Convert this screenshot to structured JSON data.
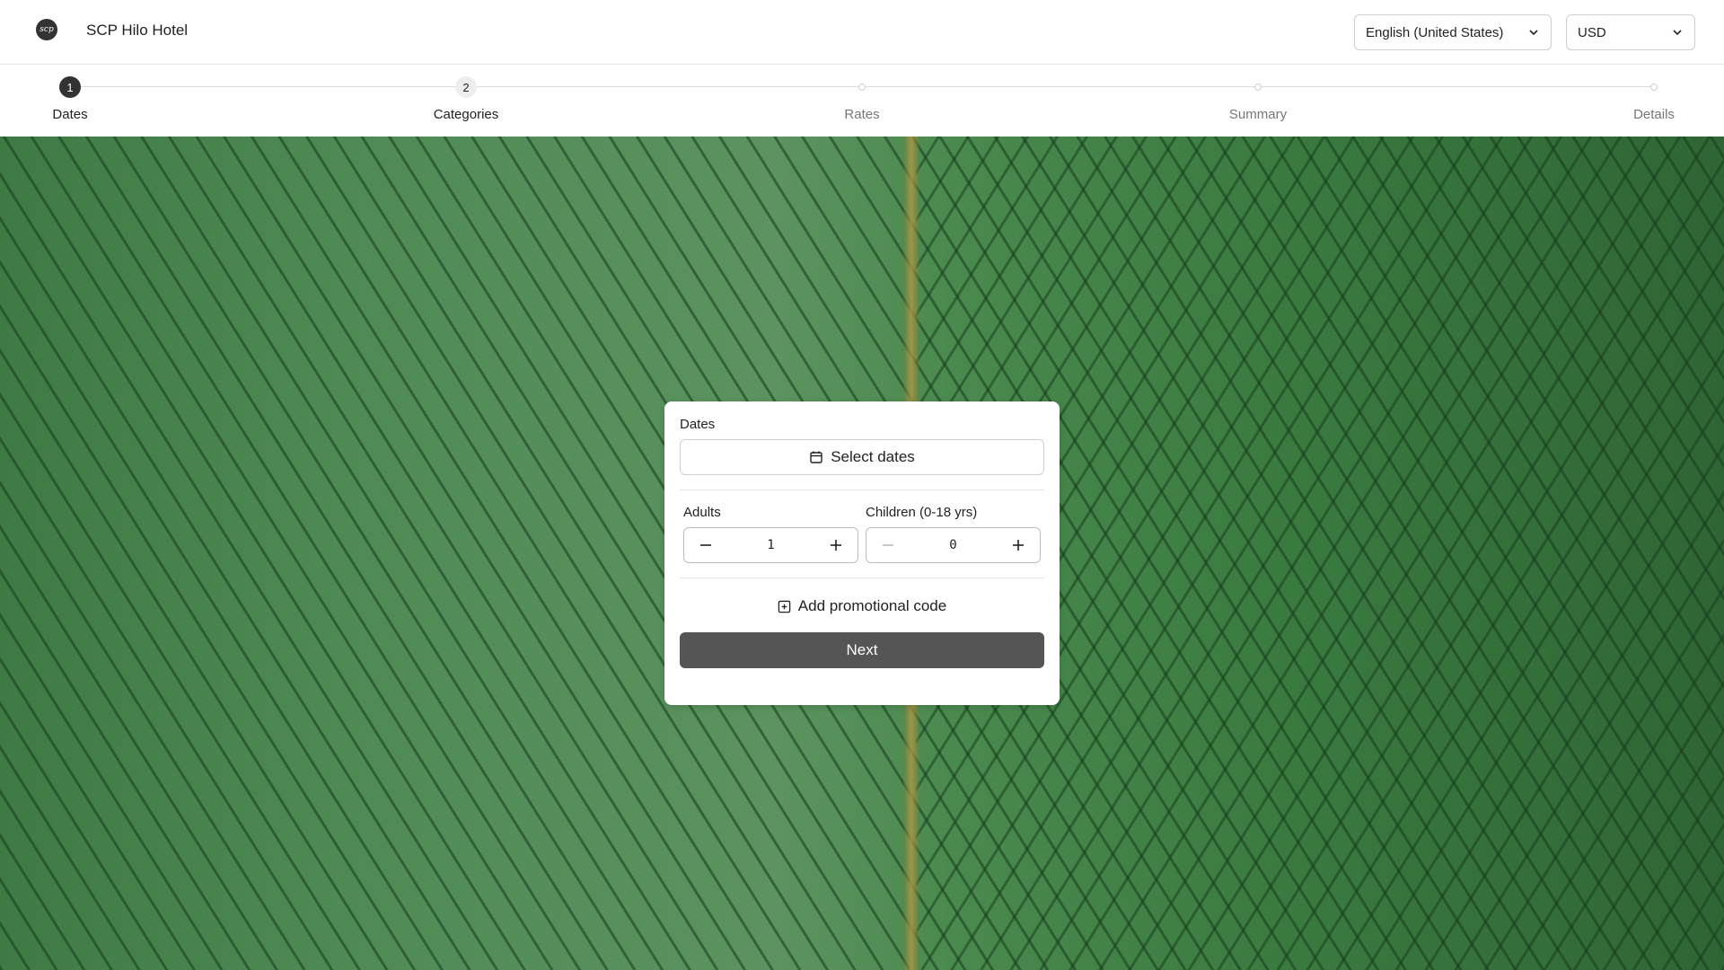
{
  "header": {
    "hotel_name": "SCP Hilo Hotel",
    "language": "English (United States)",
    "currency": "USD"
  },
  "stepper": {
    "steps": [
      {
        "number": "1",
        "label": "Dates",
        "state": "active"
      },
      {
        "number": "2",
        "label": "Categories",
        "state": "numbered"
      },
      {
        "number": "",
        "label": "Rates",
        "state": "pending"
      },
      {
        "number": "",
        "label": "Summary",
        "state": "pending"
      },
      {
        "number": "",
        "label": "Details",
        "state": "pending"
      }
    ]
  },
  "booking": {
    "dates_label": "Dates",
    "select_dates": "Select dates",
    "adults_label": "Adults",
    "adults_value": "1",
    "children_label": "Children (0-18 yrs)",
    "children_value": "0",
    "promo_label": "Add promotional code",
    "next_label": "Next"
  },
  "colors": {
    "primary_button": "#555555",
    "active_step": "#333333"
  },
  "icons": {
    "logo": "hotel-logo",
    "calendar": "calendar-icon",
    "minus": "minus-icon",
    "plus": "plus-icon",
    "add_box": "add-box-icon",
    "chevron": "chevron-down-icon"
  }
}
